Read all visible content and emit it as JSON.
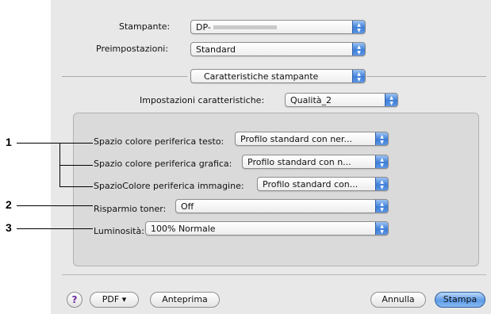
{
  "printer": {
    "label": "Stampante:",
    "value": "DP-"
  },
  "presets": {
    "label": "Preimpostazioni:",
    "value": "Standard"
  },
  "section": {
    "value": "Caratteristiche stampante"
  },
  "feature_set": {
    "label": "Impostazioni caratteristiche:",
    "value": "Qualità_2"
  },
  "settings": [
    {
      "label": "Spazio colore periferica testo:",
      "value": "Profilo standard con ner..."
    },
    {
      "label": "Spazio colore periferica grafica:",
      "value": "Profilo standard con n..."
    },
    {
      "label": "SpazioColore periferica immagine:",
      "value": "Profilo standard con..."
    },
    {
      "label": "Risparmio toner:",
      "value": "Off"
    },
    {
      "label": "Luminosità:",
      "value": "100% Normale"
    }
  ],
  "callouts": [
    "1",
    "2",
    "3"
  ],
  "buttons": {
    "help": "?",
    "pdf": "PDF ▾",
    "preview": "Anteprima",
    "cancel": "Annulla",
    "print": "Stampa"
  },
  "colors": {
    "accent": "#4a8be0",
    "dialog_bg": "#e8e8e8",
    "panel_bg": "#dadada"
  }
}
